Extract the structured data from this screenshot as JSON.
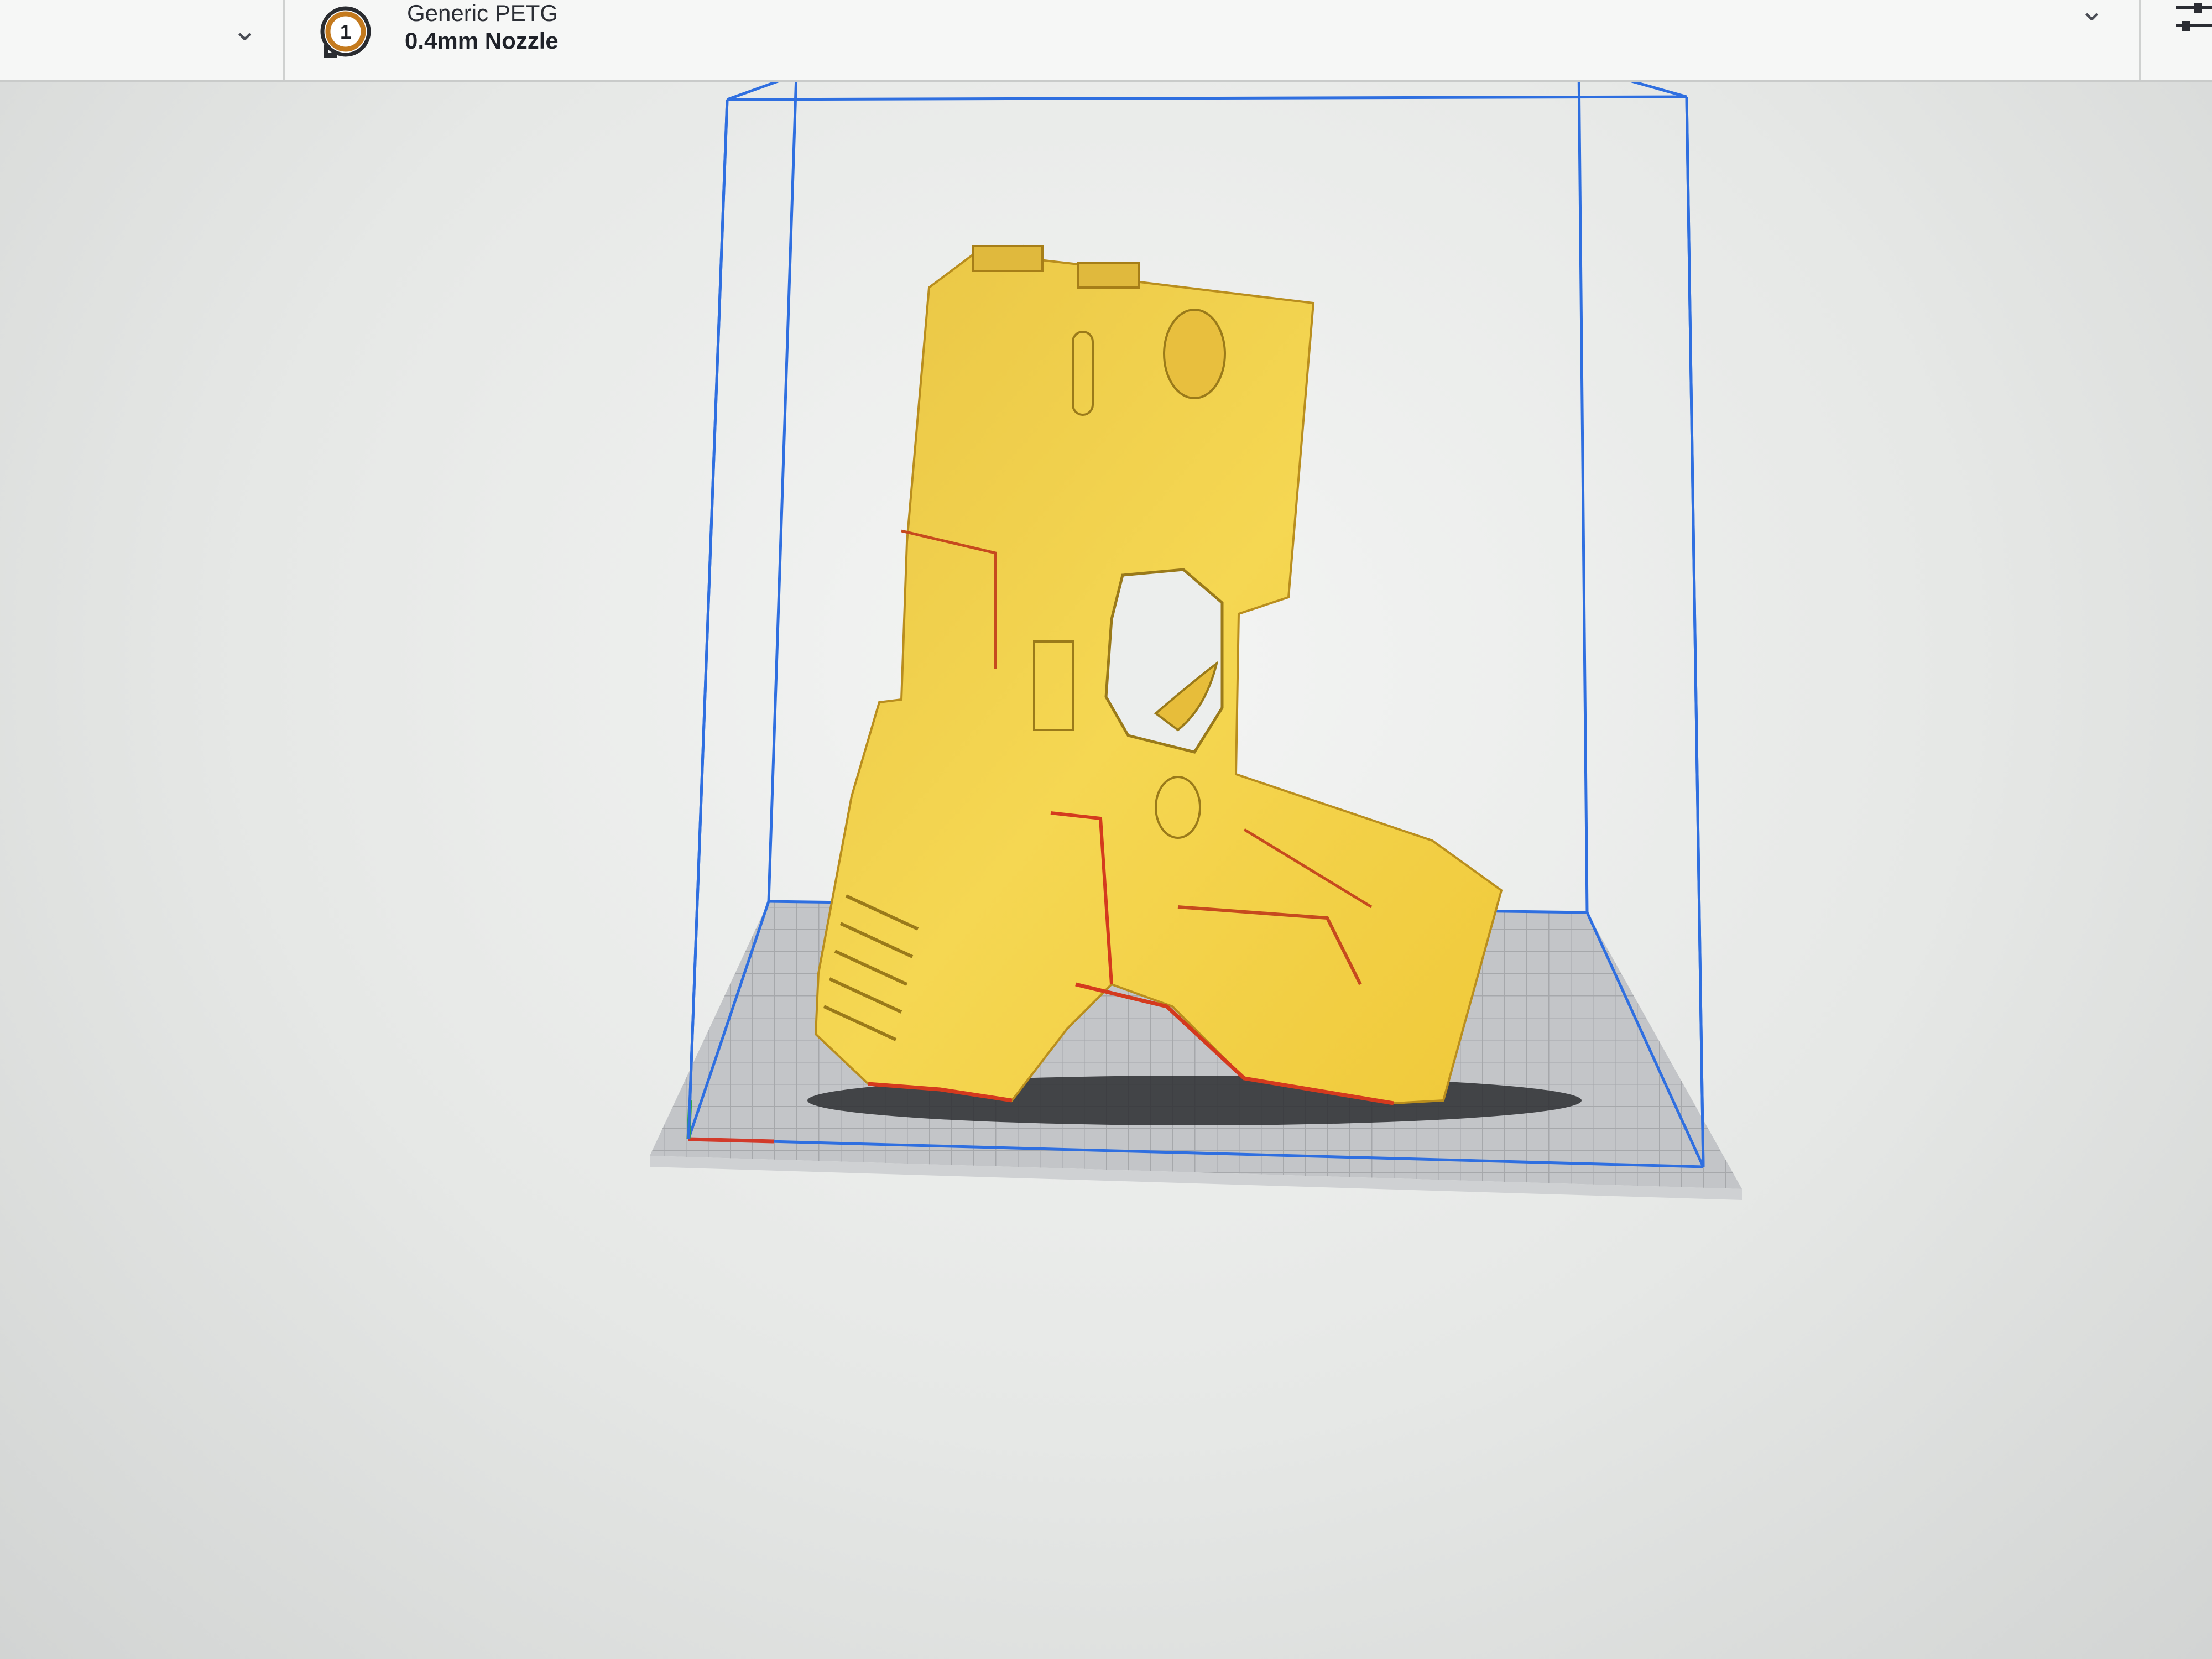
{
  "toolbar": {
    "extruder_number": "1",
    "material": "Generic PETG",
    "nozzle": "0.4mm Nozzle"
  },
  "icons": {
    "left_dropdown": "chevron-down-icon",
    "right_dropdown": "chevron-down-icon",
    "settings": "sliders-icon",
    "extruder": "extruder-badge-icon"
  },
  "colors": {
    "model": "#f2d04a",
    "model_edge": "#d43a1e",
    "build_volume": "#2f6fe0",
    "build_plate": "#b9bbbe",
    "accent": "#c47a1e"
  }
}
